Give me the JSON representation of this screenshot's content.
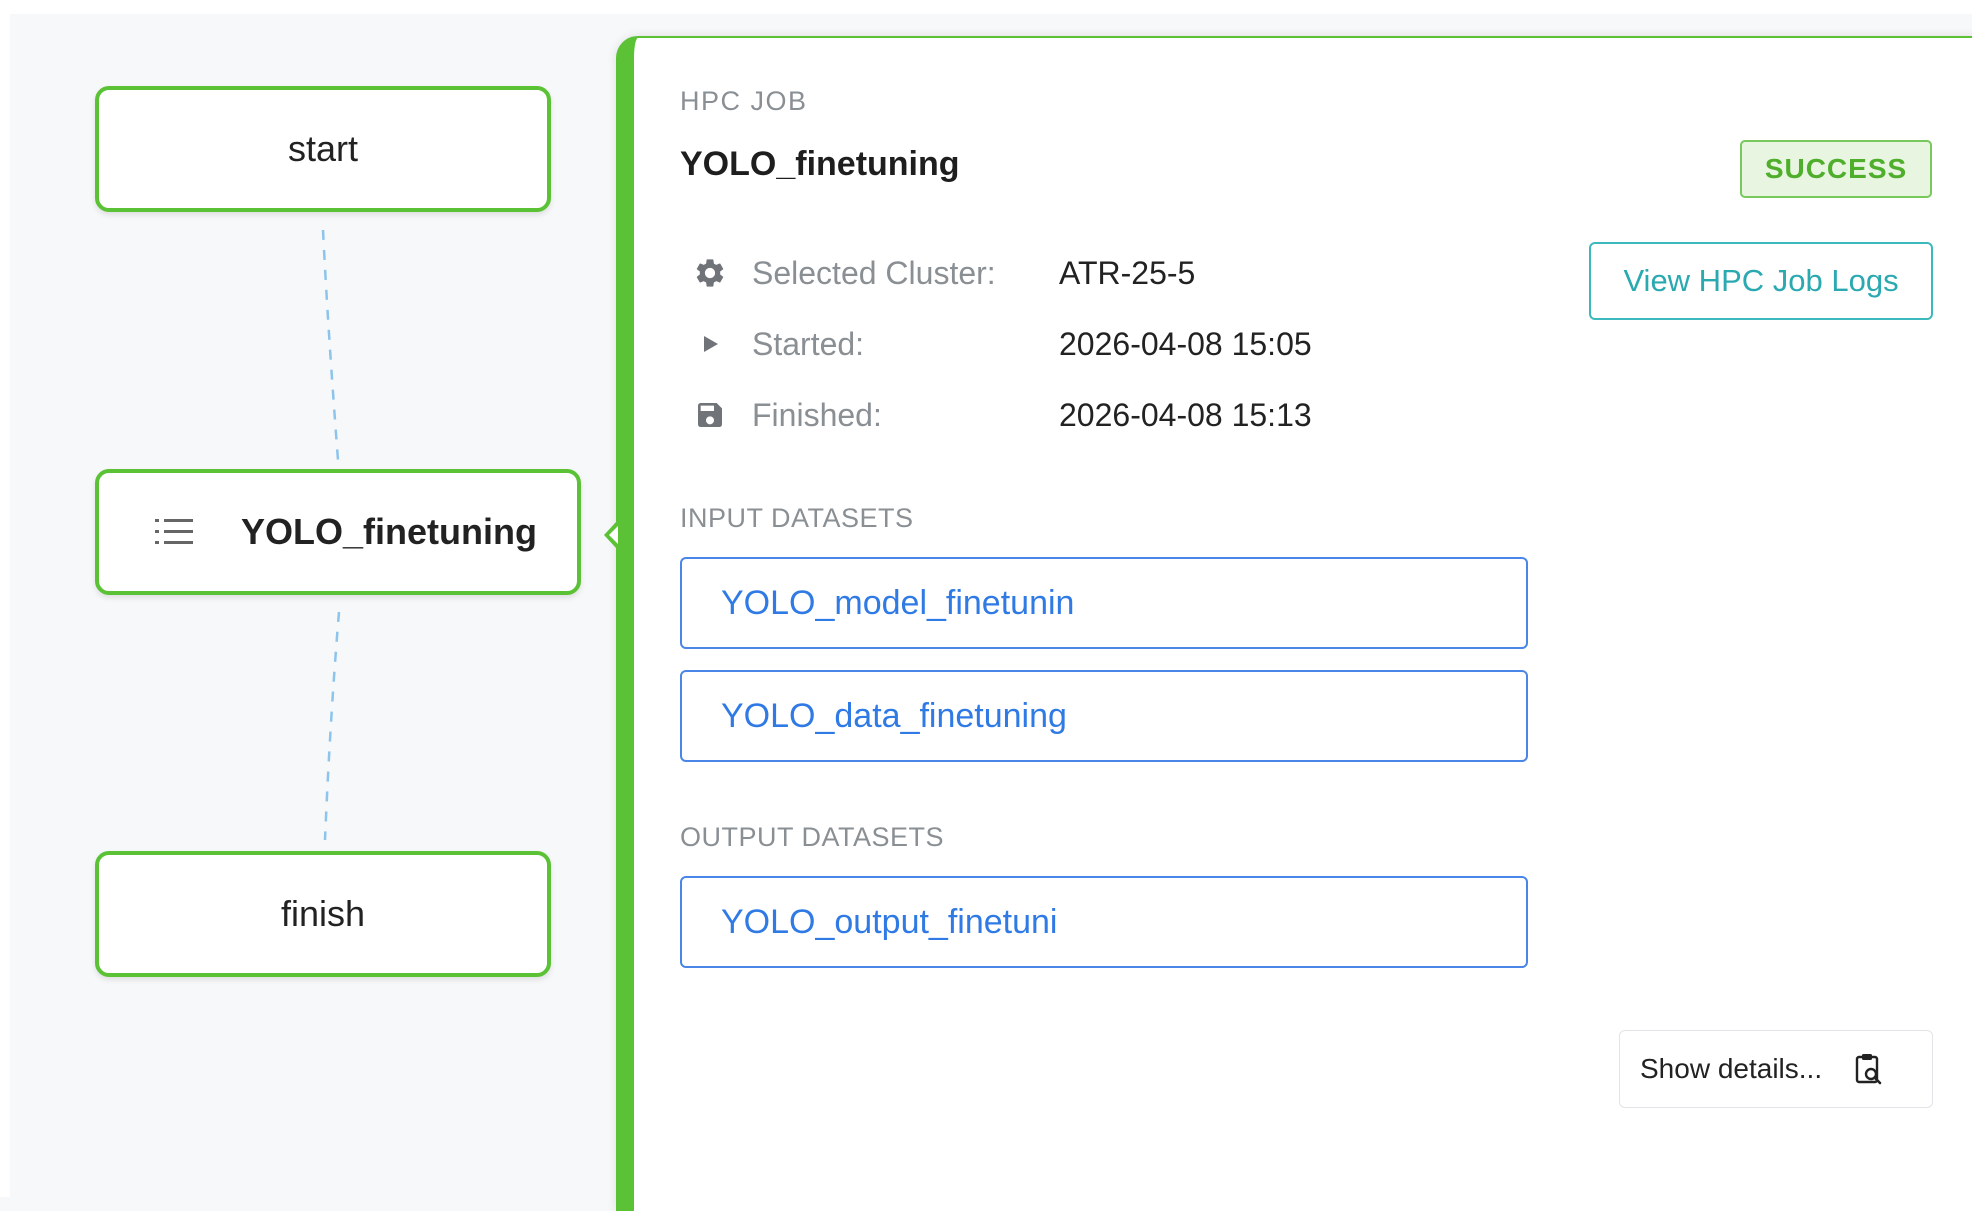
{
  "flow": {
    "nodes": {
      "start": "start",
      "job": "YOLO_finetuning",
      "finish": "finish"
    }
  },
  "panel": {
    "section_label": "HPC JOB",
    "title": "YOLO_finetuning",
    "status": "SUCCESS",
    "logs_button": "View HPC Job Logs",
    "meta": {
      "cluster_label": "Selected Cluster:",
      "cluster_value": "ATR-25-5",
      "started_label": "Started:",
      "started_value": "2026-04-08 15:05",
      "finished_label": "Finished:",
      "finished_value": "2026-04-08 15:13"
    },
    "input_label": "INPUT DATASETS",
    "inputs": [
      "YOLO_model_finetunin",
      "YOLO_data_finetuning"
    ],
    "output_label": "OUTPUT DATASETS",
    "outputs": [
      "YOLO_output_finetuni"
    ],
    "details_button": "Show details..."
  },
  "icons": {
    "job_node": "list-icon",
    "cluster": "gear-icon",
    "started": "play-icon",
    "finished": "save-icon",
    "details": "clipboard-search-icon"
  },
  "colors": {
    "success_green": "#5bc236",
    "link_blue": "#2f7ae5",
    "teal": "#2aa9b0"
  }
}
